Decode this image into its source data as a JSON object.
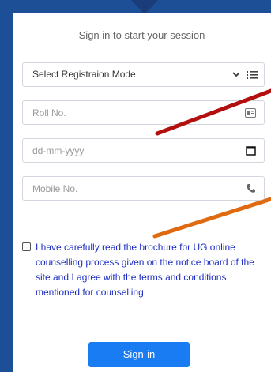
{
  "title": "Sign in to start your session",
  "registration_mode": {
    "selected": "Select Registraion Mode"
  },
  "roll_no": {
    "placeholder": "Roll No."
  },
  "dob": {
    "placeholder": "dd-mm-yyyy"
  },
  "mobile": {
    "placeholder": "Mobile No."
  },
  "agreement": {
    "text": "I have carefully read the brochure for UG online counselling process given on the notice board of the site and I agree with the terms and conditions mentioned for counselling.",
    "checked": false
  },
  "signin_label": "Sign-in",
  "colors": {
    "background": "#1d4f96",
    "button": "#1a7cf2",
    "agreement_text": "#1c2dc4",
    "arrow_red": "#b30f0f",
    "arrow_orange": "#e06a10"
  },
  "icons": [
    "chevron-down-icon",
    "list-icon",
    "id-card-icon",
    "calendar-icon",
    "phone-icon"
  ]
}
